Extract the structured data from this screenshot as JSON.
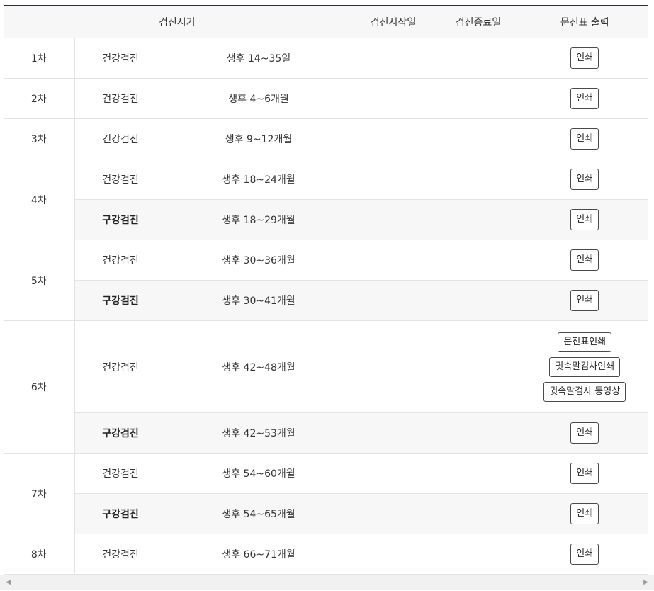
{
  "header": {
    "period": "검진시기",
    "start": "검진시작일",
    "end": "검진종료일",
    "print": "문진표 출력"
  },
  "rows": [
    {
      "round": "1차",
      "type": "건강검진",
      "age": "생후 14~35일",
      "button": "인쇄"
    },
    {
      "round": "2차",
      "type": "건강검진",
      "age": "생후 4~6개월",
      "button": "인쇄"
    },
    {
      "round": "3차",
      "type": "건강검진",
      "age": "생후 9~12개월",
      "button": "인쇄"
    },
    {
      "round": "4차",
      "type": "건강검진",
      "age": "생후 18~24개월",
      "button": "인쇄"
    },
    {
      "round": "",
      "type": "구강검진",
      "age": "생후 18~29개월",
      "button": "인쇄"
    },
    {
      "round": "5차",
      "type": "건강검진",
      "age": "생후 30~36개월",
      "button": "인쇄"
    },
    {
      "round": "",
      "type": "구강검진",
      "age": "생후 30~41개월",
      "button": "인쇄"
    },
    {
      "round": "6차",
      "type": "건강검진",
      "age": "생후 42~48개월",
      "buttons": [
        "문진표인쇄",
        "귓속말검사인쇄",
        "귓속말검사 동영상"
      ]
    },
    {
      "round": "",
      "type": "구강검진",
      "age": "생후 42~53개월",
      "button": "인쇄"
    },
    {
      "round": "7차",
      "type": "건강검진",
      "age": "생후 54~60개월",
      "button": "인쇄"
    },
    {
      "round": "",
      "type": "구강검진",
      "age": "생후 54~65개월",
      "button": "인쇄"
    },
    {
      "round": "8차",
      "type": "건강검진",
      "age": "생후 66~71개월",
      "button": "인쇄"
    }
  ],
  "scrollbar": {
    "left": "◀",
    "right": "▶"
  }
}
